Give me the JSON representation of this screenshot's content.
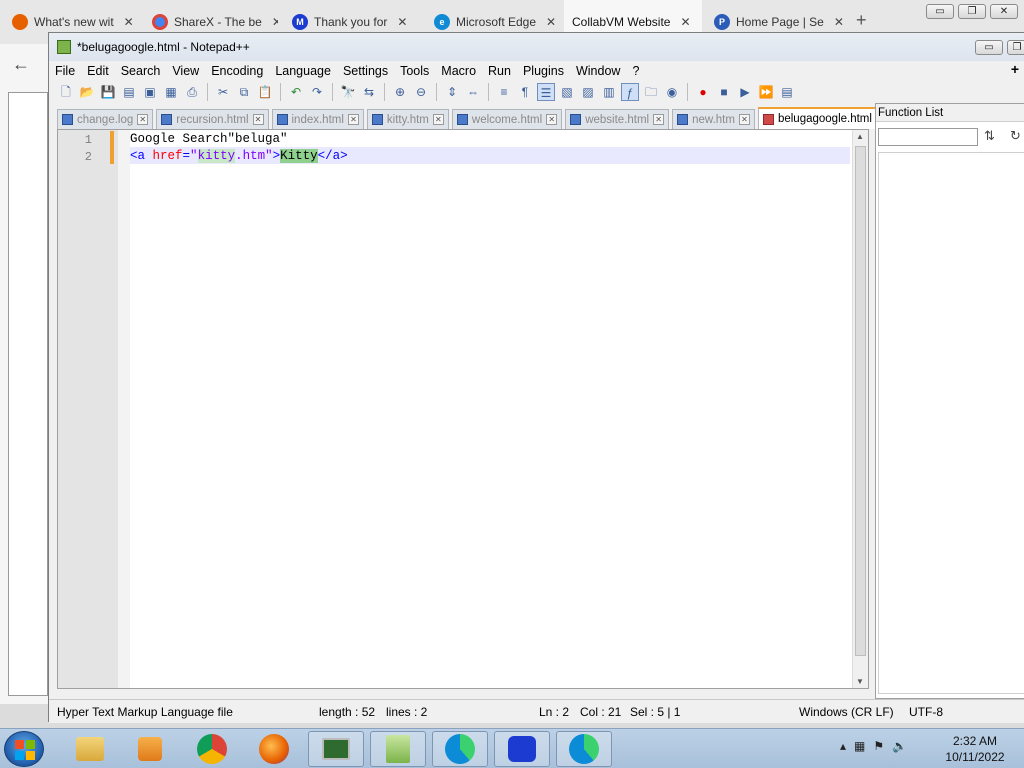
{
  "browser": {
    "tabs": [
      {
        "label": "What's new wit",
        "icon": "firefox-icon"
      },
      {
        "label": "ShareX - The be",
        "icon": "chrome-icon"
      },
      {
        "label": "Thank you for",
        "icon": "malwarebytes-icon"
      },
      {
        "label": "Microsoft Edge",
        "icon": "edge-icon"
      },
      {
        "label": "CollabVM Website",
        "icon": "page-icon"
      },
      {
        "label": "Home Page | Se",
        "icon": "pbs-icon"
      }
    ],
    "new_tab": "+",
    "win_buttons": {
      "minimize": "▭",
      "restore": "❐",
      "close": "✕"
    }
  },
  "npp": {
    "title": "*belugagoogle.html - Notepad++",
    "menu": [
      "File",
      "Edit",
      "Search",
      "View",
      "Encoding",
      "Language",
      "Settings",
      "Tools",
      "Macro",
      "Run",
      "Plugins",
      "Window",
      "?"
    ],
    "menu_plus": "+",
    "file_tabs": [
      {
        "label": "change.log",
        "active": false
      },
      {
        "label": "recursion.html",
        "active": false
      },
      {
        "label": "index.html",
        "active": false
      },
      {
        "label": "kitty.htm",
        "active": false
      },
      {
        "label": "welcome.html",
        "active": false
      },
      {
        "label": "website.html",
        "active": false
      },
      {
        "label": "new.htm",
        "active": false
      },
      {
        "label": "belugagoogle.html",
        "active": true
      }
    ],
    "editor": {
      "lines": [
        {
          "num": "1",
          "text": "Google Search\"beluga\""
        },
        {
          "num": "2",
          "parts": {
            "open_bracket": "<a ",
            "attr": "href",
            "eq": "=",
            "quote1": "\"",
            "val_hl": "kitty",
            "val_rest": ".htm",
            "quote2": "\"",
            "gt": ">",
            "text_hl": "Kitty",
            "close": "</a>"
          }
        }
      ]
    },
    "function_list": {
      "title": "Function List",
      "sort_icon": "sort-az-icon",
      "reload_icon": "reload-icon"
    },
    "status": {
      "file_type": "Hyper Text Markup Language file",
      "length": "length : 52",
      "lines": "lines : 2",
      "ln": "Ln : 2",
      "col": "Col : 21",
      "sel": "Sel : 5 | 1",
      "eol": "Windows (CR LF)",
      "encoding": "UTF-8"
    }
  },
  "taskbar": {
    "items": [
      "explorer-icon",
      "media-player-icon",
      "chrome-icon",
      "firefox-icon",
      "task-manager-icon",
      "notepadpp-icon",
      "edge-icon",
      "malwarebytes-icon",
      "edge-alt-icon"
    ],
    "clock_time": "2:32 AM",
    "clock_date": "10/11/2022"
  },
  "colors": {
    "accent_tab": "#f0a030",
    "tag": "#0000ff",
    "attr": "#ff0000",
    "string": "#8000ff",
    "match_highlight": "#8fd08f"
  }
}
